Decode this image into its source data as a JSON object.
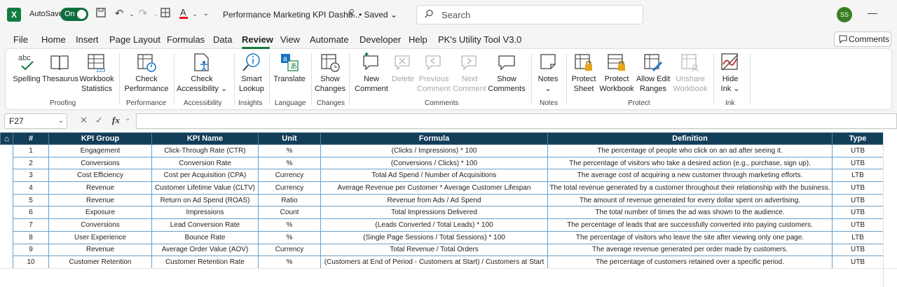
{
  "titlebar": {
    "autosave_label": "AutoSave",
    "autosave_state": "On",
    "doc_title": "Performance Marketing KPI Dashb...",
    "saved": "• Saved ⌄",
    "search_placeholder": "Search",
    "avatar_initials": "SS"
  },
  "menu": {
    "tabs": [
      "File",
      "Home",
      "Insert",
      "Page Layout",
      "Formulas",
      "Data",
      "Review",
      "View",
      "Automate",
      "Developer",
      "Help",
      "PK's Utility Tool V3.0"
    ],
    "active_tab": "Review",
    "comments_button": "Comments"
  },
  "ribbon": {
    "spelling": "Spelling",
    "thesaurus": "Thesaurus",
    "workbook_statistics_1": "Workbook",
    "workbook_statistics_2": "Statistics",
    "proofing": "Proofing",
    "check_performance_1": "Check",
    "check_performance_2": "Performance",
    "performance": "Performance",
    "check_accessibility_1": "Check",
    "check_accessibility_2": "Accessibility ⌄",
    "accessibility": "Accessibility",
    "smart_lookup_1": "Smart",
    "smart_lookup_2": "Lookup",
    "insights": "Insights",
    "translate": "Translate",
    "language": "Language",
    "show_changes_1": "Show",
    "show_changes_2": "Changes",
    "changes": "Changes",
    "new_comment_1": "New",
    "new_comment_2": "Comment",
    "delete": "Delete",
    "previous_comment_1": "Previous",
    "previous_comment_2": "Comment",
    "next_comment_1": "Next",
    "next_comment_2": "Comment",
    "show_comments_1": "Show",
    "show_comments_2": "Comments",
    "comments_group": "Comments",
    "notes_1": "Notes",
    "notes_2": "⌄",
    "notes_group": "Notes",
    "protect_sheet_1": "Protect",
    "protect_sheet_2": "Sheet",
    "protect_workbook_1": "Protect",
    "protect_workbook_2": "Workbook",
    "allow_edit_ranges_1": "Allow Edit",
    "allow_edit_ranges_2": "Ranges",
    "unshare_workbook_1": "Unshare",
    "unshare_workbook_2": "Workbook",
    "protect_group": "Protect",
    "hide_ink_1": "Hide",
    "hide_ink_2": "Ink ⌄",
    "ink_group": "Ink"
  },
  "formula_bar": {
    "name_box": "F27",
    "fx": "fx"
  },
  "table": {
    "headers": [
      "#",
      "KPI Group",
      "KPI Name",
      "Unit",
      "Formula",
      "Definition",
      "Type"
    ],
    "rows": [
      [
        "1",
        "Engagement",
        "Click-Through Rate (CTR)",
        "%",
        "(Clicks / Impressions) * 100",
        "The percentage of people who click on an ad after seeing it.",
        "UTB"
      ],
      [
        "2",
        "Conversions",
        "Conversion Rate",
        "%",
        "(Conversions / Clicks) * 100",
        "The percentage of visitors who take a desired action (e.g., purchase, sign up).",
        "UTB"
      ],
      [
        "3",
        "Cost Efficiency",
        "Cost per Acquisition (CPA)",
        "Currency",
        "Total Ad Spend / Number of Acquisitions",
        "The average cost of acquiring a new customer through marketing efforts.",
        "LTB"
      ],
      [
        "4",
        "Revenue",
        "Customer Lifetime Value (CLTV)",
        "Currency",
        "Average Revenue per Customer * Average Customer Lifespan",
        "The total revenue generated by a customer throughout their relationship with the business.",
        "UTB"
      ],
      [
        "5",
        "Revenue",
        "Return on Ad Spend (ROAS)",
        "Ratio",
        "Revenue from Ads / Ad Spend",
        "The amount of revenue generated for every dollar spent on advertising.",
        "UTB"
      ],
      [
        "6",
        "Exposure",
        "Impressions",
        "Count",
        "Total Impressions Delivered",
        "The total number of times the ad was shown to the audience.",
        "UTB"
      ],
      [
        "7",
        "Conversions",
        "Lead Conversion Rate",
        "%",
        "(Leads Converted / Total Leads) * 100",
        "The percentage of leads that are successfully converted into paying customers.",
        "UTB"
      ],
      [
        "8",
        "User Experience",
        "Bounce Rate",
        "%",
        "(Single Page Sessions / Total Sessions) * 100",
        "The percentage of visitors who leave the site after viewing only one page.",
        "LTB"
      ],
      [
        "9",
        "Revenue",
        "Average Order Value (AOV)",
        "Currency",
        "Total Revenue / Total Orders",
        "The average revenue generated per order made by customers.",
        "UTB"
      ],
      [
        "10",
        "Customer Retention",
        "Customer Retention Rate",
        "%",
        "(Customers at End of Period - Customers at Start) / Customers at Start",
        "The percentage of customers retained over a specific period.",
        "UTB"
      ]
    ]
  },
  "colors": {
    "header_bg": "#133e5a",
    "excel_green": "#107c41",
    "cell_border": "#6aa0c8"
  }
}
